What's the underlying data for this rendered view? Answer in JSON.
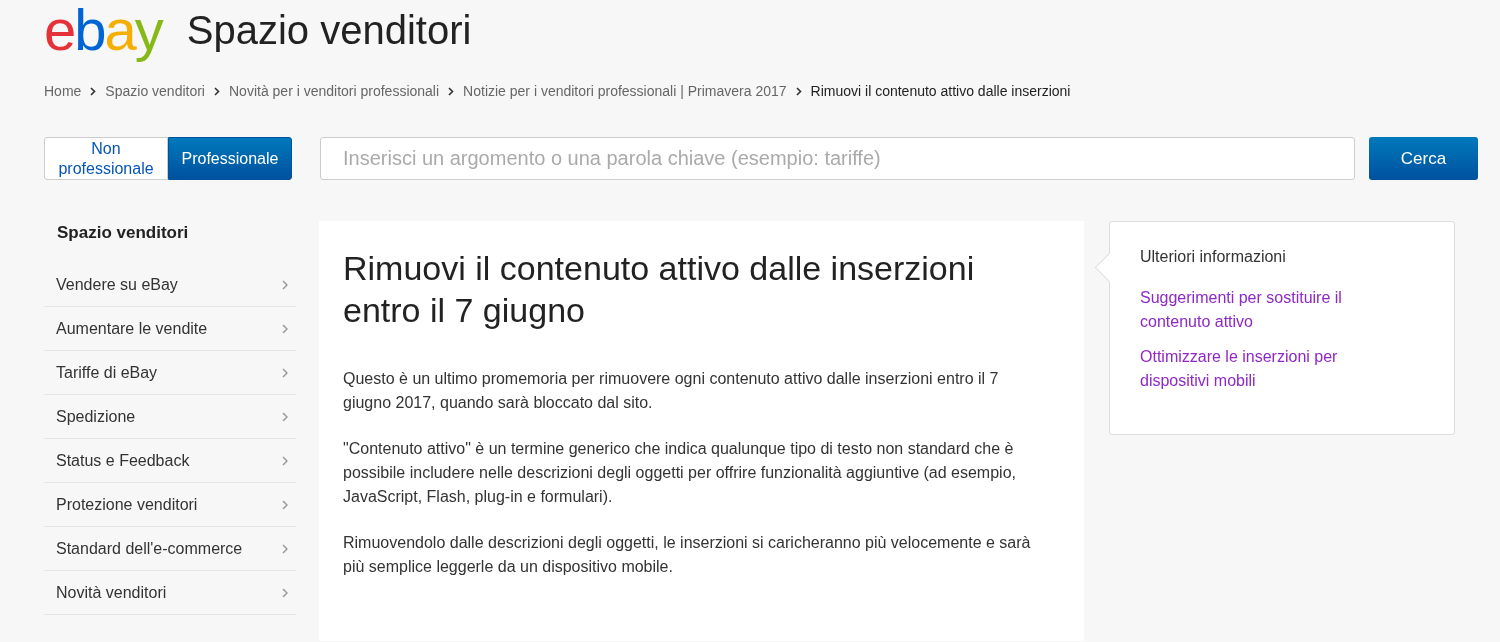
{
  "header": {
    "logo": "ebay",
    "title": "Spazio venditori"
  },
  "breadcrumb": [
    {
      "label": "Home",
      "current": false
    },
    {
      "label": "Spazio venditori",
      "current": false
    },
    {
      "label": "Novità per i venditori professionali",
      "current": false
    },
    {
      "label": "Notizie per i venditori professionali | Primavera 2017",
      "current": false
    },
    {
      "label": "Rimuovi il contenuto attivo dalle inserzioni",
      "current": true
    }
  ],
  "seller_toggle": [
    {
      "label": "Non professionale",
      "selected": false
    },
    {
      "label": "Professionale",
      "selected": true
    }
  ],
  "search": {
    "placeholder": "Inserisci un argomento o una parola chiave (esempio: tariffe)",
    "button": "Cerca"
  },
  "sidebar": {
    "title": "Spazio venditori",
    "items": [
      {
        "label": "Vendere su eBay"
      },
      {
        "label": "Aumentare le vendite"
      },
      {
        "label": "Tariffe di eBay"
      },
      {
        "label": "Spedizione"
      },
      {
        "label": "Status e Feedback"
      },
      {
        "label": "Protezione venditori"
      },
      {
        "label": "Standard dell'e-commerce"
      },
      {
        "label": "Novità venditori"
      }
    ]
  },
  "article": {
    "title": "Rimuovi il contenuto attivo dalle inserzioni entro il 7 giugno",
    "paragraphs": [
      "Questo è un ultimo promemoria per rimuovere ogni contenuto attivo dalle inserzioni entro il 7 giugno 2017, quando sarà bloccato dal sito.",
      "\"Contenuto attivo\" è un termine generico che indica qualunque tipo di testo non standard che è possibile includere nelle descrizioni degli oggetti per offrire funzionalità aggiuntive (ad esempio, JavaScript, Flash, plug-in e formulari).",
      "Rimuovendolo dalle descrizioni degli oggetti, le inserzioni si caricheranno più velocemente e sarà più semplice leggerle da un dispositivo mobile."
    ]
  },
  "more_info": {
    "title": "Ulteriori informazioni",
    "links": [
      "Suggerimenti per sostituire il contenuto attivo",
      "Ottimizzare le inserzioni per dispositivi mobili"
    ]
  }
}
